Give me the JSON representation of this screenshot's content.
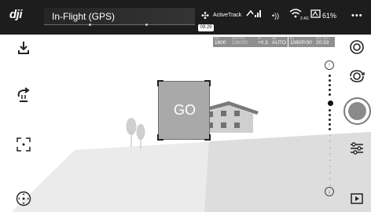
{
  "topbar": {
    "logo": "dji",
    "mode": "In-Flight (GPS)",
    "countdown": "09:29",
    "activetrack": "ActiveTrack",
    "signal_glyph": "•))",
    "wifi_sub": "2.4G",
    "battery": "61%",
    "more": "•••"
  },
  "left_tools": {
    "takeoff_icon": "download-arrow",
    "return_home_icon": "return-home",
    "track_icon": "focus-frame",
    "joystick_icon": "joystick"
  },
  "camera_settings": {
    "iso_label": "ISO",
    "iso": "1600",
    "shutter_label": "SHUTTER",
    "shutter": "1/8000",
    "ev_label": "EV",
    "ev": "+0.3",
    "wb_label": "WB",
    "wb": "AUTO",
    "format_label": "SD",
    "format": "1080P/30",
    "time_label": "REC TIME",
    "time": "20:33"
  },
  "target": {
    "label": "GO"
  },
  "right_controls": {
    "icons": [
      "settings-circle-icon",
      "camera-switch-icon",
      "shutter-button",
      "sliders-icon",
      "playback-icon"
    ]
  },
  "zoom_slider": {
    "level": 0.33
  },
  "colors": {
    "topbar": "#1d1d1d",
    "shutter_inner": "#8a8a8a",
    "ground_left": "#e9e9e9",
    "ground_right": "#dcdcdc"
  }
}
